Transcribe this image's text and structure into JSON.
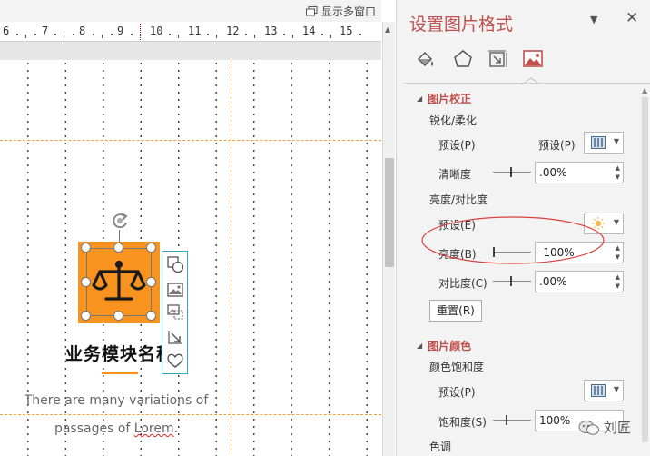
{
  "window": {
    "multiwin_label": "显示多窗口"
  },
  "ruler": {
    "numbers": [
      "6",
      "7",
      "8",
      "9",
      "10",
      "11",
      "12",
      "13",
      "14",
      "15"
    ]
  },
  "slide": {
    "module_title": "业务模块名称",
    "body_line1": "There are many variations of",
    "body_line2a": "passages of ",
    "body_line2b": "Lorem",
    "body_line2c": ".",
    "accent_color": "#f7931e"
  },
  "side_tools": [
    "shape-icon",
    "image-icon",
    "crop-icon",
    "resize-icon",
    "heart-icon"
  ],
  "pane": {
    "title": "设置图片格式",
    "tabs": [
      "fill-line-icon",
      "effects-icon",
      "size-property-icon",
      "picture-icon"
    ],
    "section_correction": "图片校正",
    "sharpen_soften": "锐化/柔化",
    "preset_label_1": "预设(P)",
    "preset_label_2": "预设(P)",
    "clarity_label": "清晰度",
    "clarity_value": ".00%",
    "brightness_contrast": "亮度/对比度",
    "preset_label_3": "预设(E)",
    "brightness_label": "亮度(B)",
    "brightness_value": "-100%",
    "contrast_label": "对比度(C)",
    "contrast_value": ".00%",
    "reset_button": "重置(R)",
    "section_color": "图片颜色",
    "saturation_section": "颜色饱和度",
    "preset_label_4": "预设(P)",
    "saturation_label": "饱和度(S)",
    "saturation_value": "100%",
    "tone": "色调",
    "accent_color": "#c0504d"
  },
  "watermark": "刘匠"
}
